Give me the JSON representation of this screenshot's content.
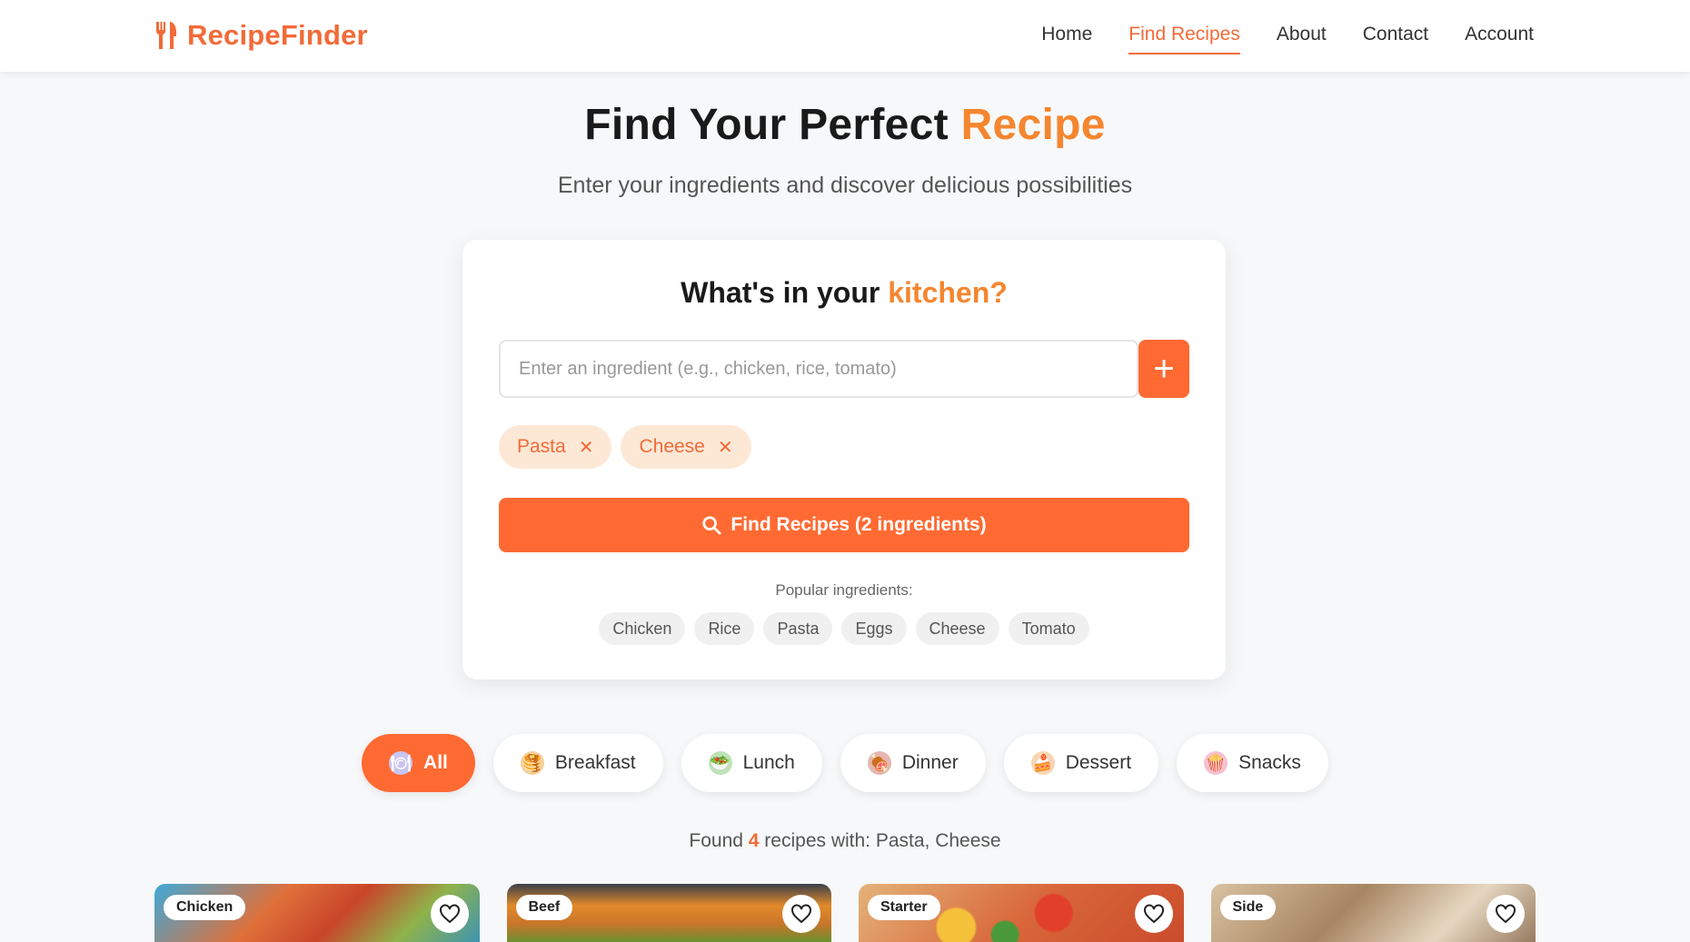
{
  "header": {
    "brand": "RecipeFinder",
    "nav": [
      {
        "label": "Home",
        "active": false
      },
      {
        "label": "Find Recipes",
        "active": true
      },
      {
        "label": "About",
        "active": false
      },
      {
        "label": "Contact",
        "active": false
      },
      {
        "label": "Account",
        "active": false
      }
    ]
  },
  "hero": {
    "title_main": "Find Your Perfect ",
    "title_accent": "Recipe",
    "subtitle": "Enter your ingredients and discover delicious possibilities"
  },
  "search": {
    "title_main": "What's in your ",
    "title_accent": "kitchen?",
    "input_placeholder": "Enter an ingredient (e.g., chicken, rice, tomato)",
    "input_value": "",
    "add_label": "+",
    "selected": [
      "Pasta",
      "Cheese"
    ],
    "find_label": "Find Recipes (2 ingredients)",
    "popular_label": "Popular ingredients:",
    "popular": [
      "Chicken",
      "Rice",
      "Pasta",
      "Eggs",
      "Cheese",
      "Tomato"
    ]
  },
  "categories": [
    {
      "label": "All",
      "icon": "plate-icon",
      "active": true
    },
    {
      "label": "Breakfast",
      "icon": "pancake-icon",
      "active": false
    },
    {
      "label": "Lunch",
      "icon": "salad-icon",
      "active": false
    },
    {
      "label": "Dinner",
      "icon": "meat-icon",
      "active": false
    },
    {
      "label": "Dessert",
      "icon": "cake-icon",
      "active": false
    },
    {
      "label": "Snacks",
      "icon": "popcorn-icon",
      "active": false
    }
  ],
  "results": {
    "prefix": "Found ",
    "count": "4",
    "suffix": " recipes with: Pasta, Cheese"
  },
  "recipes": [
    {
      "badge": "Chicken"
    },
    {
      "badge": "Beef"
    },
    {
      "badge": "Starter"
    },
    {
      "badge": "Side"
    }
  ],
  "colors": {
    "accent": "#ff6a33",
    "brand": "#f26b38",
    "title_accent": "#f5862f",
    "tag_bg": "#fde8d6"
  }
}
